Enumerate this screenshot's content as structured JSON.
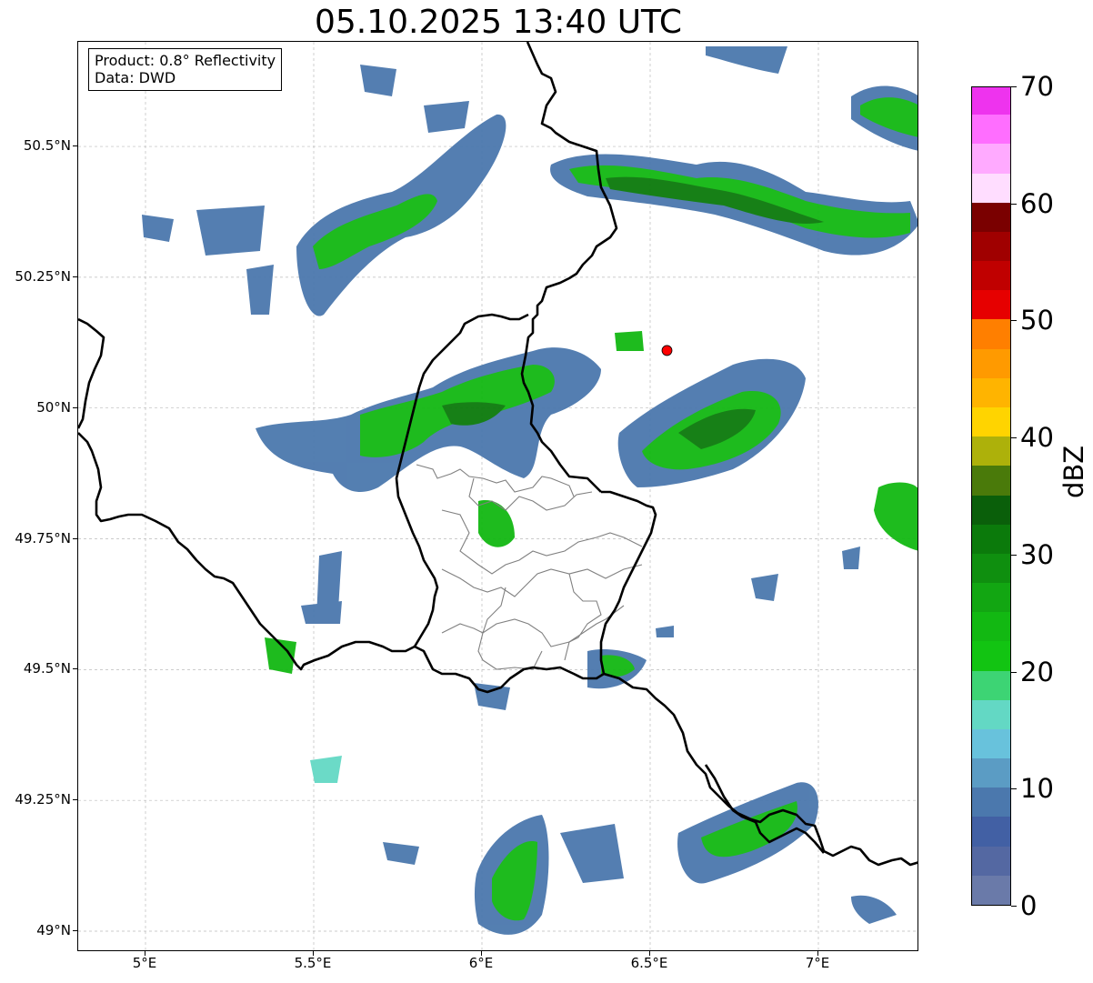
{
  "title": "05.10.2025 13:40 UTC",
  "info": {
    "product": "Product: 0.8° Reflectivity",
    "data": "Data: DWD"
  },
  "map": {
    "lon_range": [
      4.8,
      7.3
    ],
    "lat_range": [
      48.96,
      50.7
    ],
    "x_ticks": [
      {
        "value": 5.0,
        "label": "5°E"
      },
      {
        "value": 5.5,
        "label": "5.5°E"
      },
      {
        "value": 6.0,
        "label": "6°E"
      },
      {
        "value": 6.5,
        "label": "6.5°E"
      },
      {
        "value": 7.0,
        "label": "7°E"
      }
    ],
    "y_ticks": [
      {
        "value": 50.5,
        "label": "50.5°N"
      },
      {
        "value": 50.25,
        "label": "50.25°N"
      },
      {
        "value": 50.0,
        "label": "50°N"
      },
      {
        "value": 49.75,
        "label": "49.75°N"
      },
      {
        "value": 49.5,
        "label": "49.5°N"
      },
      {
        "value": 49.25,
        "label": "49.25°N"
      },
      {
        "value": 49.0,
        "label": "49°N"
      }
    ],
    "gridlines": true,
    "radar_site": {
      "lon": 6.55,
      "lat": 50.11,
      "color": "#ff0000"
    }
  },
  "colorbar": {
    "label": "dBZ",
    "min": 0,
    "max": 70,
    "ticks": [
      0,
      10,
      20,
      30,
      40,
      50,
      60,
      70
    ],
    "colors": [
      "#6a7aa9",
      "#5468a2",
      "#4260a4",
      "#4b78ad",
      "#5b9cc4",
      "#68c2dc",
      "#63d8c4",
      "#3dd474",
      "#12c412",
      "#12b812",
      "#12a612",
      "#0f8f0f",
      "#0b7a0b",
      "#0a5f0a",
      "#4a7a0a",
      "#adb10a",
      "#ffd400",
      "#ffb400",
      "#ff9a00",
      "#ff7f00",
      "#e60000",
      "#c00000",
      "#a00000",
      "#7a0000",
      "#ffddff",
      "#ffaaff",
      "#ff6eff",
      "#ee33ee"
    ]
  }
}
